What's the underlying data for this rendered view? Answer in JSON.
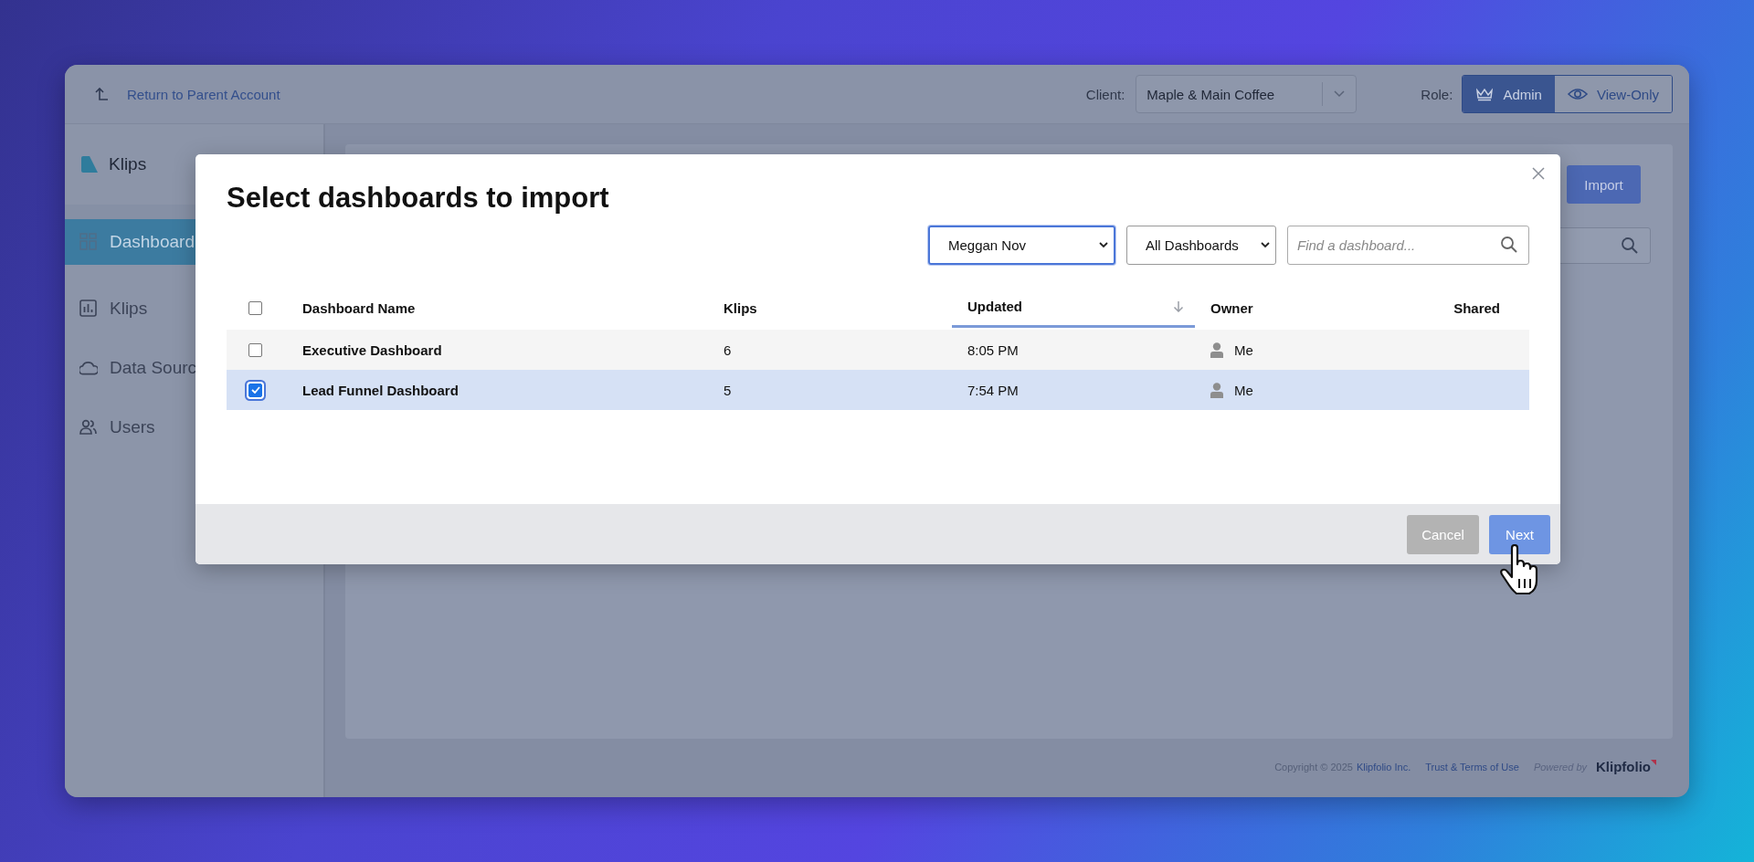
{
  "top_bar": {
    "back_link": "Return to Parent Account",
    "client_label": "Client:",
    "client_value": "Maple & Main Coffee",
    "role_label": "Role:",
    "roles": [
      {
        "label": "Admin",
        "selected": true
      },
      {
        "label": "View-Only",
        "selected": false
      }
    ]
  },
  "sidebar": {
    "brand": "Klips",
    "items": [
      {
        "label": "Dashboard",
        "selected": true
      },
      {
        "label": "Klips",
        "selected": false
      },
      {
        "label": "Data Sourc",
        "selected": false
      },
      {
        "label": "Users",
        "selected": false
      }
    ]
  },
  "main": {
    "import_button": "Import"
  },
  "footer": {
    "copyright": "Copyright © 2025",
    "company_link": "Klipfolio Inc.",
    "terms_link": "Trust & Terms of Use",
    "powered_by": "Powered by",
    "brand": "Klipfolio"
  },
  "dialog": {
    "title": "Select dashboards to import",
    "owner_filter": "Meggan Nov",
    "type_filter": "All Dashboards",
    "search": {
      "placeholder": "Find a dashboard..."
    },
    "select_all": {
      "checked": false
    },
    "columns": [
      {
        "label": "Dashboard Name",
        "sorted": false
      },
      {
        "label": "Klips",
        "sorted": false
      },
      {
        "label": "Updated",
        "sorted": true
      },
      {
        "label": "Owner",
        "sorted": false
      },
      {
        "label": "Shared",
        "sorted": false
      }
    ],
    "rows": [
      {
        "name": "Executive Dashboard",
        "klips": "6",
        "updated": "8:05 PM",
        "owner": "Me",
        "selected": false
      },
      {
        "name": "Lead Funnel Dashboard",
        "klips": "5",
        "updated": "7:54 PM",
        "owner": "Me",
        "selected": true
      }
    ],
    "buttons": [
      {
        "label": "Cancel",
        "kind": "secondary"
      },
      {
        "label": "Next",
        "kind": "primary"
      }
    ]
  }
}
